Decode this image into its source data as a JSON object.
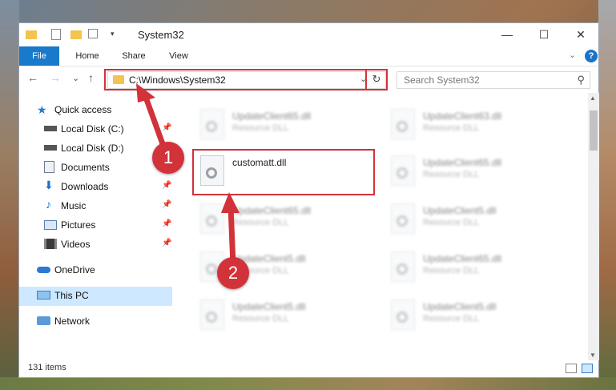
{
  "window": {
    "title": "System32"
  },
  "window_controls": {
    "minimize": "—",
    "maximize": "☐",
    "close": "✕"
  },
  "ribbon": {
    "tabs": [
      "File",
      "Home",
      "Share",
      "View"
    ],
    "collapse": "⌄",
    "help": "?"
  },
  "nav": {
    "back": "←",
    "forward": "→",
    "recent": "⌄",
    "up": "↑"
  },
  "address": {
    "path": "C:\\Windows\\System32",
    "dropdown": "⌄",
    "refresh": "↻"
  },
  "search": {
    "placeholder": "Search System32",
    "icon": "⚲"
  },
  "sidebar": {
    "items": [
      {
        "label": "Quick access",
        "icon": "star-icon",
        "pinned": false
      },
      {
        "label": "Local Disk (C:)",
        "icon": "drive-icon",
        "pinned": true
      },
      {
        "label": "Local Disk (D:)",
        "icon": "drive-icon",
        "pinned": false
      },
      {
        "label": "Documents",
        "icon": "documents-icon",
        "pinned": true
      },
      {
        "label": "Downloads",
        "icon": "downloads-icon",
        "pinned": true
      },
      {
        "label": "Music",
        "icon": "music-icon",
        "pinned": true
      },
      {
        "label": "Pictures",
        "icon": "pictures-icon",
        "pinned": true
      },
      {
        "label": "Videos",
        "icon": "videos-icon",
        "pinned": true
      },
      {
        "label": "OneDrive",
        "icon": "cloud-icon",
        "pinned": false
      },
      {
        "label": "This PC",
        "icon": "pc-icon",
        "pinned": false
      },
      {
        "label": "Network",
        "icon": "network-icon",
        "pinned": false
      }
    ],
    "pin_glyph": "📌"
  },
  "files": [
    {
      "name": "UpdateClient65.dll",
      "type": "Resource DLL"
    },
    {
      "name": "UpdateClient63.dll",
      "type": "Resource DLL"
    },
    {
      "name": "customatt.dll",
      "type": ""
    },
    {
      "name": "UpdateClient65.dll",
      "type": "Resource DLL"
    },
    {
      "name": "UpdateClient65.dll",
      "type": "Resource DLL"
    },
    {
      "name": "UpdateClient5.dll",
      "type": "Resource DLL"
    },
    {
      "name": "UpdateClient5.dll",
      "type": "Resource DLL"
    },
    {
      "name": "UpdateClient65.dll",
      "type": "Resource DLL"
    },
    {
      "name": "UpdateClient5.dll",
      "type": "Resource DLL"
    },
    {
      "name": "UpdateClient5.dll",
      "type": "Resource DLL"
    }
  ],
  "status": {
    "item_count": "131 items"
  },
  "annotations": {
    "step1": "1",
    "step2": "2"
  },
  "colors": {
    "accent": "#1979ca",
    "highlight": "#d2323a",
    "selected": "#cde8ff"
  }
}
